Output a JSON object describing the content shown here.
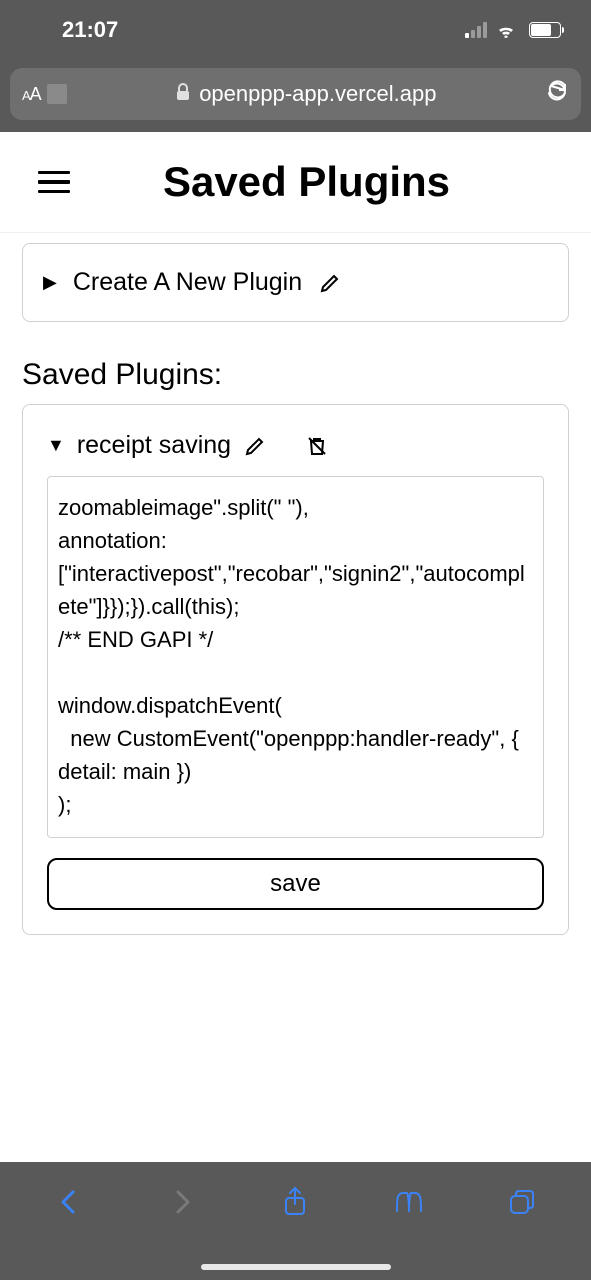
{
  "status": {
    "time": "21:07"
  },
  "browser": {
    "url": "openppp-app.vercel.app"
  },
  "header": {
    "title": "Saved Plugins"
  },
  "createPanel": {
    "label": "Create A New Plugin"
  },
  "sectionTitle": "Saved Plugins:",
  "plugin": {
    "name": "receipt saving",
    "code": "zoomableimage\".split(\" \"),\nannotation:\n[\"interactivepost\",\"recobar\",\"signin2\",\"autocomplete\"]}});}).call(this);\n/** END GAPI */\n\nwindow.dispatchEvent(\n  new CustomEvent(\"openppp:handler-ready\", { detail: main })\n);",
    "saveLabel": "save"
  }
}
